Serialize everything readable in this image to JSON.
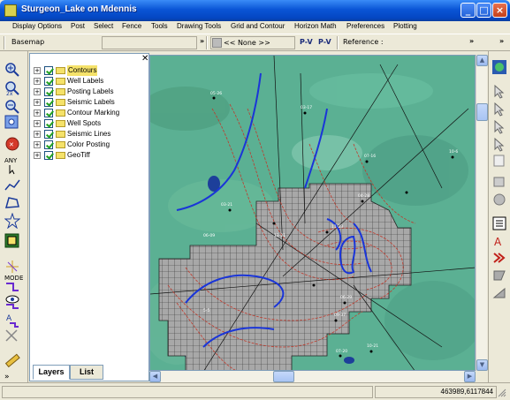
{
  "window": {
    "title": "Sturgeon_Lake on Mdennis"
  },
  "menu": {
    "items": [
      "Display Options",
      "Post",
      "Select",
      "Fence",
      "Tools",
      "Drawing Tools",
      "Grid and Contour",
      "Horizon Math",
      "Preferences",
      "Plotting"
    ]
  },
  "toolbar": {
    "basemap_label": "Basemap",
    "horizon_select": "<< None >>",
    "pv_button_1": "P-V",
    "pv_button_2": "P-V",
    "reference_label": "Reference :",
    "overflow": "»"
  },
  "layers": {
    "items": [
      {
        "label": "Contours",
        "checked": true,
        "selected": true
      },
      {
        "label": "Well Labels",
        "checked": true
      },
      {
        "label": "Posting Labels",
        "checked": true
      },
      {
        "label": "Seismic Labels",
        "checked": true
      },
      {
        "label": "Contour Marking",
        "checked": true
      },
      {
        "label": "Well Spots",
        "checked": true
      },
      {
        "label": "Seismic Lines",
        "checked": true
      },
      {
        "label": "Color Posting",
        "checked": true
      },
      {
        "label": "GeoTiff",
        "checked": true
      }
    ],
    "tabs": [
      "Layers",
      "List"
    ]
  },
  "left_tools": {
    "any_label": "ANY",
    "mode_label": "MODE"
  },
  "status": {
    "coordinates": "463989,6117844"
  },
  "colors": {
    "titlebar": "#0a55d6",
    "map_bg": "#5bb093",
    "contour_red": "#c0392b",
    "contour_blue": "#1a35d8",
    "grid_fill": "#a8a8a8"
  }
}
